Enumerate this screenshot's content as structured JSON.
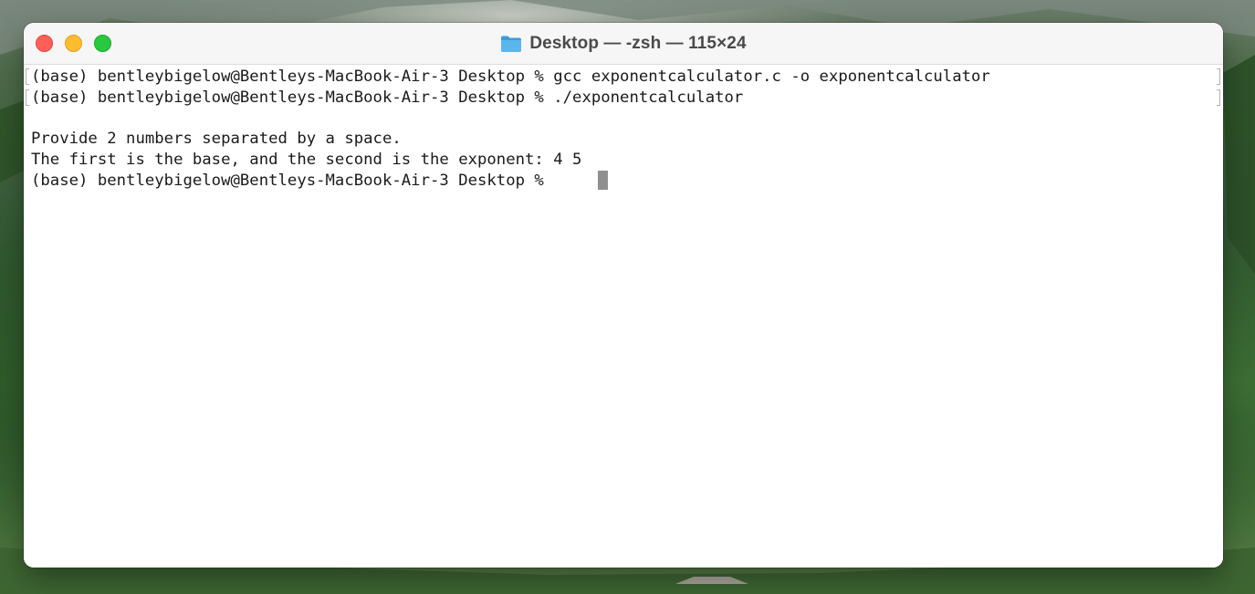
{
  "window": {
    "title": "Desktop — -zsh — 115×24",
    "title_icon": "folder-icon",
    "traffic_lights": [
      {
        "name": "close",
        "color": "#fe5f57"
      },
      {
        "name": "minimize",
        "color": "#febc2e"
      },
      {
        "name": "zoom",
        "color": "#28c840"
      }
    ]
  },
  "terminal": {
    "lines": [
      "(base) bentleybigelow@Bentleys-MacBook-Air-3 Desktop % gcc exponentcalculator.c -o exponentcalculator",
      "(base) bentleybigelow@Bentleys-MacBook-Air-3 Desktop % ./exponentcalculator",
      "",
      "Provide 2 numbers separated by a space.",
      "The first is the base, and the second is the exponent: 4 5",
      "(base) bentleybigelow@Bentleys-MacBook-Air-3 Desktop % "
    ],
    "text_color": "#1a1a1a",
    "background": "#ffffff",
    "cursor_color": "#8f8f8f"
  }
}
